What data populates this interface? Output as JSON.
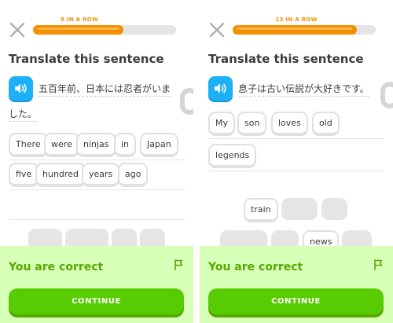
{
  "theme": {
    "progress_color": "#f49000",
    "speaker_color": "#1cb0f6",
    "correct_banner_color": "#d7ffb8",
    "correct_text_color": "#58a700",
    "continue_color": "#58cc02"
  },
  "left": {
    "streak_label": "8 IN A ROW",
    "progress_fraction": 0.63,
    "heading": "Translate this sentence",
    "prompt_line1": "五百年前、日本には忍者がいま",
    "prompt_line2": "した。",
    "answer_words": [
      "There",
      "were",
      "ninjas",
      "in",
      "Japan",
      "five",
      "hundred",
      "years",
      "ago"
    ],
    "feedback_title": "You are correct",
    "continue_label": "CONTINUE"
  },
  "right": {
    "streak_label": "13 IN A ROW",
    "progress_fraction": 0.87,
    "heading": "Translate this sentence",
    "prompt_line1": "息子は古い伝説が大好きです。",
    "answer_words": [
      "My",
      "son",
      "loves",
      "old",
      "legends"
    ],
    "bank_words": [
      "train",
      "news"
    ],
    "feedback_title": "You are correct",
    "continue_label": "CONTINUE"
  },
  "icons": {
    "close": "close-icon",
    "speaker": "speaker-icon",
    "flag": "flag-icon"
  }
}
